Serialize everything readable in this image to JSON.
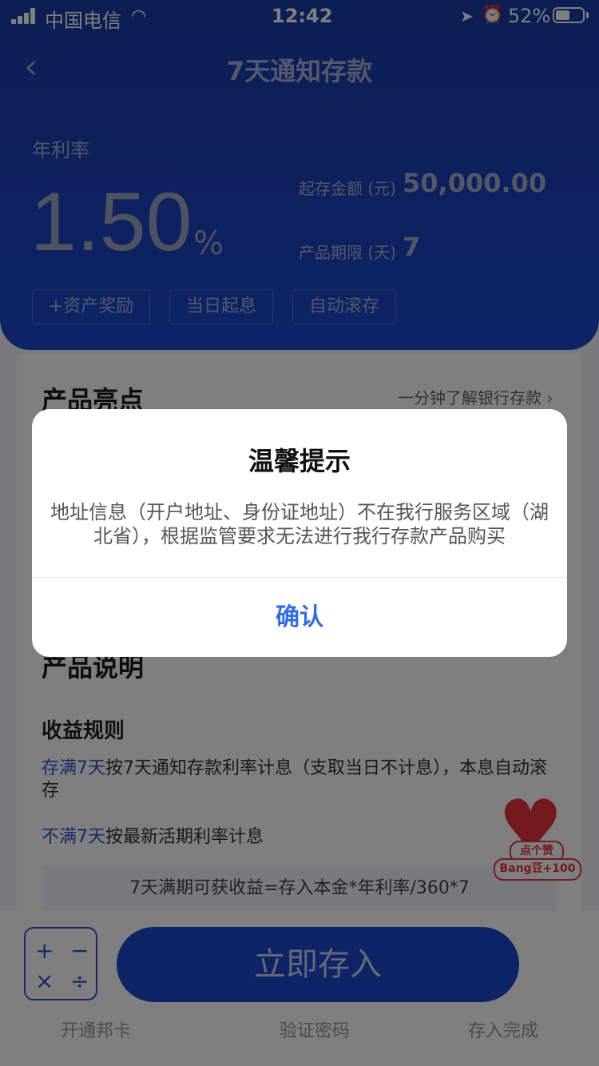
{
  "status_bar": {
    "carrier": "中国电信",
    "time": "12:42",
    "battery": "52%",
    "battery_level": 0.52
  },
  "header": {
    "title": "7天通知存款",
    "rate_label": "年利率",
    "rate_value": "1.50",
    "rate_unit": "%",
    "min_amount_label": "起存金额 (元)",
    "min_amount_value": "50,000.00",
    "term_label": "产品期限 (天)",
    "term_value": "7",
    "tags": [
      "+资产奖励",
      "当日起息",
      "自动滚存"
    ]
  },
  "content": {
    "highlights_title": "产品亮点",
    "learn_link": "一分钟了解银行存款",
    "desc_title": "产品说明",
    "rules_title": "收益规则",
    "rule1_highlight": "存满7天",
    "rule1_text": "按7天通知存款利率计息（支取当日不计息），本息自动滚存",
    "rule2_highlight": "不满7天",
    "rule2_text": "按最新活期利率计息",
    "formula": "7天满期可获收益=存入本金*年利率/360*7"
  },
  "badge": {
    "line1": "点个赞",
    "line2": "Bang豆+100"
  },
  "bottom": {
    "calc_symbols": [
      "+",
      "−",
      "×",
      "÷"
    ],
    "cta": "立即存入",
    "steps": [
      "开通邦卡",
      "验证密码",
      "存入完成"
    ]
  },
  "dialog": {
    "title": "温馨提示",
    "message": "地址信息（开户地址、身份证地址）不在我行服务区域（湖北省），根据监管要求无法进行我行存款产品购买",
    "confirm": "确认"
  },
  "icons": {
    "back": "chevron-left-icon",
    "wifi": "wifi-icon",
    "location": "location-arrow-icon",
    "alarm": "alarm-icon",
    "link_arrow": "chevron-right-icon"
  },
  "colors": {
    "brand_blue": "#1d49cf",
    "confirm_blue": "#2f6ce6",
    "heart_red": "#e8333a"
  }
}
